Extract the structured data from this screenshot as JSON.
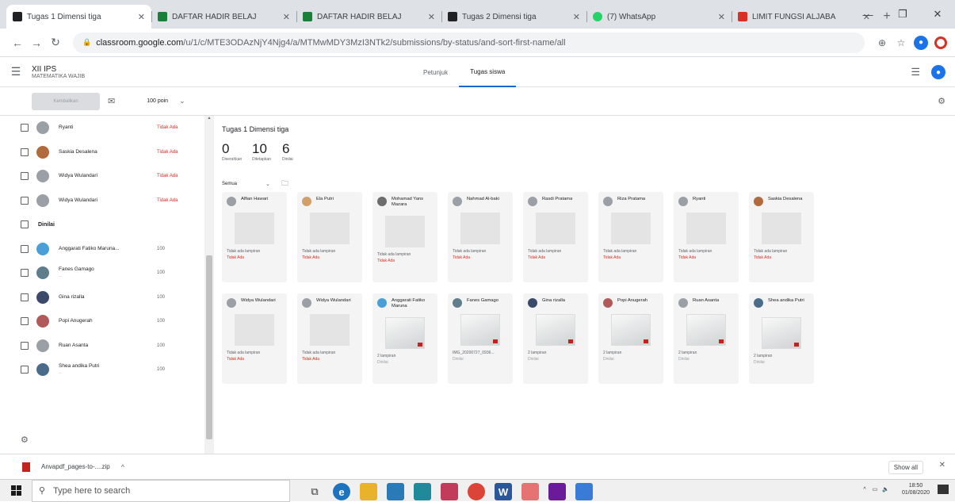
{
  "browser": {
    "tabs": [
      {
        "title": "Tugas 1 Dimensi tiga",
        "color": "#202124"
      },
      {
        "title": "DAFTAR HADIR BELAJ",
        "color": "#188038"
      },
      {
        "title": "DAFTAR HADIR BELAJ",
        "color": "#188038"
      },
      {
        "title": "Tugas 2 Dimensi tiga",
        "color": "#202124"
      },
      {
        "title": "(7) WhatsApp",
        "color": "#25d366"
      },
      {
        "title": "LIMIT FUNGSI ALJABA",
        "color": "#d93025"
      }
    ],
    "url_domain": "classroom.google.com",
    "url_path": "/u/1/c/MTE3ODAzNjY4Njg4/a/MTMwMDY3MzI3NTk2/submissions/by-status/and-sort-first-name/all"
  },
  "classroom": {
    "class_name": "XII IPS",
    "class_sub": "MATEMATIKA WAJIB",
    "tabs": [
      "Petunjuk",
      "Tugas siswa"
    ]
  },
  "toolbar": {
    "return_label": "Kembalikan",
    "points": "100 poin"
  },
  "students": [
    {
      "name": "Ryanti",
      "grade": "Tidak Ada",
      "missing": true,
      "color": "#9aa0a6"
    },
    {
      "name": "Saskia Desalena",
      "grade": "Tidak Ada",
      "missing": true,
      "color": "#b06a3b"
    },
    {
      "name": "Widya Wulandari",
      "grade": "Tidak Ada",
      "missing": true,
      "color": "#9aa0a6"
    },
    {
      "name": "Widya Wulandari",
      "grade": "Tidak Ada",
      "missing": true,
      "color": "#9aa0a6"
    }
  ],
  "group_label": "Dinilai",
  "graded": [
    {
      "name": "Anggarati Fatiko Maruna...",
      "grade": "100",
      "color": "#4a9fd8"
    },
    {
      "name": "Fanes Gamago",
      "sub": "...",
      "grade": "100",
      "color": "#607d8b"
    },
    {
      "name": "Gina rizalla",
      "grade": "100",
      "color": "#3b4a6b"
    },
    {
      "name": "Popi Anugerah",
      "grade": "100",
      "color": "#b05a5a"
    },
    {
      "name": "Ruan Asanta",
      "grade": "100",
      "color": "#9aa0a6"
    },
    {
      "name": "Shea andika Putri",
      "sub": "...",
      "grade": "100",
      "color": "#4a6b8a"
    }
  ],
  "assignment": {
    "title": "Tugas 1 Dimensi tiga",
    "stats": [
      {
        "num": "0",
        "label": "Diserahkan"
      },
      {
        "num": "10",
        "label": "Ditetapkan"
      },
      {
        "num": "6",
        "label": "Dinilai"
      }
    ],
    "filter": "Semua"
  },
  "cards_row1": [
    {
      "name": "Alfian Hawari",
      "l1": "Tidak ada lampiran",
      "l2": "Tidak Ada",
      "color": "#9aa0a6"
    },
    {
      "name": "Ela Putri",
      "l1": "Tidak ada lampiran",
      "l2": "Tidak Ada",
      "color": "#d3a06b"
    },
    {
      "name": "Mohamad Yans Mazara",
      "l1": "Tidak ada lampiran",
      "l2": "Tidak Ada",
      "color": "#6d6d6d"
    },
    {
      "name": "Nahmad Al-baki",
      "l1": "Tidak ada lampiran",
      "l2": "Tidak Ada",
      "color": "#9aa0a6"
    },
    {
      "name": "Rasdi Pratama",
      "l1": "Tidak ada lampiran",
      "l2": "Tidak Ada",
      "color": "#9aa0a6"
    },
    {
      "name": "Riza Pratama",
      "l1": "Tidak ada lampiran",
      "l2": "Tidak Ada",
      "color": "#9aa0a6"
    },
    {
      "name": "Ryanti",
      "l1": "Tidak ada lampiran",
      "l2": "Tidak Ada",
      "color": "#9aa0a6"
    },
    {
      "name": "Saskia Desalena",
      "l1": "Tidak ada lampiran",
      "l2": "Tidak Ada",
      "color": "#b06a3b"
    }
  ],
  "cards_row2": [
    {
      "name": "Widya Wulandari",
      "l1": "Tidak ada lampiran",
      "l2": "Tidak Ada",
      "color": "#9aa0a6"
    },
    {
      "name": "Widya Wulandari",
      "l1": "Tidak ada lampiran",
      "l2": "Tidak Ada",
      "color": "#9aa0a6"
    },
    {
      "name": "Anggarati Fatiko Maruna",
      "l1": "2 lampiran",
      "l2": "Dinilai",
      "color": "#4a9fd8"
    },
    {
      "name": "Fanes Gamago",
      "l1": "IMG_20200727_0936...",
      "l2": "Dinilai",
      "color": "#607d8b"
    },
    {
      "name": "Gina rizalla",
      "l1": "2 lampiran",
      "l2": "Dinilai",
      "color": "#3b4a6b"
    },
    {
      "name": "Popi Anugerah",
      "l1": "2 lampiran",
      "l2": "Dinilai",
      "color": "#b05a5a"
    },
    {
      "name": "Ruan Asanta",
      "l1": "2 lampiran",
      "l2": "Dinilai",
      "color": "#9aa0a6"
    },
    {
      "name": "Shea andika Putri",
      "l1": "2 lampiran",
      "l2": "Dinilai",
      "color": "#4a6b8a"
    }
  ],
  "download": {
    "filename": "Anvapdf_pages-to-....zip",
    "show_all": "Show all"
  },
  "taskbar": {
    "search_placeholder": "Type here to search",
    "time": "18:50",
    "date": "01/08/2020"
  }
}
